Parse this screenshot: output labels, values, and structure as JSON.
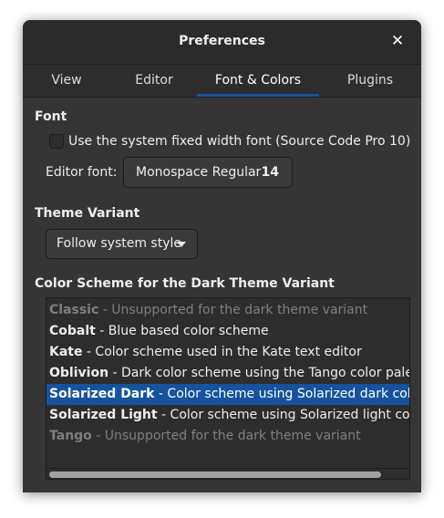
{
  "window": {
    "title": "Preferences"
  },
  "tabs": [
    {
      "label": "View",
      "active": false
    },
    {
      "label": "Editor",
      "active": false
    },
    {
      "label": "Font & Colors",
      "active": true
    },
    {
      "label": "Plugins",
      "active": false
    }
  ],
  "font": {
    "heading": "Font",
    "system_font_checkbox": {
      "label": "Use the system fixed width font (Source Code Pro 10)",
      "checked": false
    },
    "editor_font_label": "Editor font:",
    "editor_font_name": "Monospace Regular",
    "editor_font_size": "14"
  },
  "theme": {
    "heading": "Theme Variant",
    "selected": "Follow system style"
  },
  "schemes": {
    "heading": "Color Scheme for the Dark Theme Variant",
    "items": [
      {
        "name": "Classic",
        "desc": " - Unsupported for the dark theme variant",
        "state": "disabled"
      },
      {
        "name": "Cobalt",
        "desc": " - Blue based color scheme",
        "state": "normal"
      },
      {
        "name": "Kate",
        "desc": " - Color scheme used in the Kate text editor",
        "state": "normal"
      },
      {
        "name": "Oblivion",
        "desc": " - Dark color scheme using the Tango color palette",
        "state": "normal"
      },
      {
        "name": "Solarized Dark",
        "desc": " - Color scheme using Solarized dark color palette",
        "state": "selected"
      },
      {
        "name": "Solarized Light",
        "desc": " - Color scheme using Solarized light color palette",
        "state": "normal"
      },
      {
        "name": "Tango",
        "desc": " - Unsupported for the dark theme variant",
        "state": "disabled"
      }
    ]
  },
  "colors": {
    "accent": "#15539e",
    "window_bg": "#353535",
    "list_bg": "#2d2d2d"
  }
}
